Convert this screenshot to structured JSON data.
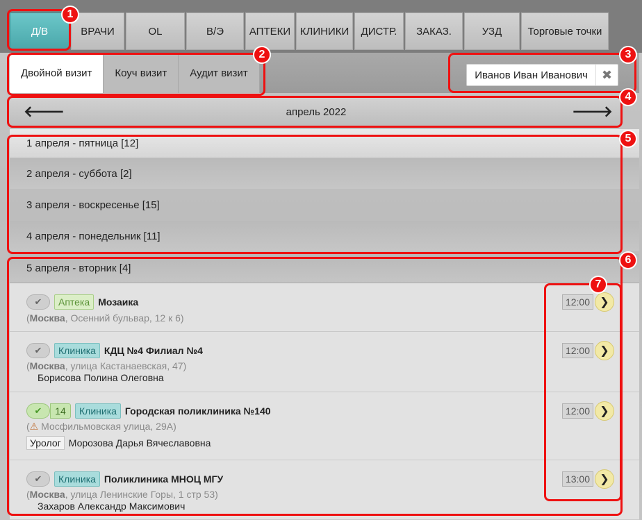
{
  "tabs": [
    "Д/В",
    "ВРАЧИ",
    "OL",
    "В/Э",
    "АПТЕКИ",
    "КЛИНИКИ",
    "ДИСТР.",
    "ЗАКАЗ.",
    "УЗД",
    "Торговые точки"
  ],
  "subtabs": [
    "Двойной визит",
    "Коуч визит",
    "Аудит визит"
  ],
  "user_filter": {
    "name": "Иванов Иван Иванович",
    "clear_icon": "close-icon"
  },
  "month": {
    "title": "апрель 2022",
    "prev_icon": "arrow-left-icon",
    "next_icon": "arrow-right-icon"
  },
  "days": [
    "1 апреля - пятница [12]",
    "2 апреля - суббота [2]",
    "3 апреля - воскресенье [15]",
    "4 апреля - понедельник [11]"
  ],
  "open_day": "5 апреля - вторник [4]",
  "visits": [
    {
      "type": "Аптека",
      "name": "Мозаика",
      "city": "Москва",
      "address": ", Осенний бульвар, 12 к 6)",
      "person": "",
      "spec": "",
      "time": "12:00",
      "count": ""
    },
    {
      "type": "Клиника",
      "name": "КДЦ №4 Филиал №4",
      "city": "Москва",
      "address": ", улица Кастанаевская, 47)",
      "person": "Борисова Полина Олеговна",
      "spec": "",
      "time": "12:00",
      "count": ""
    },
    {
      "type": "Клиника",
      "name": "Городская поликлиника №140",
      "city": "",
      "address": "Мосфильмовская улица, 29А)",
      "person": "Морозова Дарья Вячеславовна",
      "spec": "Уролог",
      "time": "12:00",
      "count": "14"
    },
    {
      "type": "Клиника",
      "name": "Поликлиника МНОЦ МГУ",
      "city": "Москва",
      "address": ", улица Ленинские Горы, 1 стр 53)",
      "person": "Захаров Александр Максимович",
      "spec": "",
      "time": "13:00",
      "count": ""
    }
  ],
  "annotations": [
    "1",
    "2",
    "3",
    "4",
    "5",
    "6",
    "7"
  ],
  "colors": {
    "accent": "#4aa7aa",
    "annotation": "#ee1111"
  }
}
